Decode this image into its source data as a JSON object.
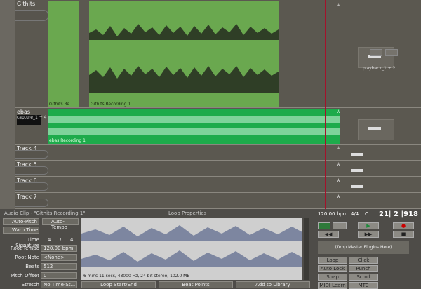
{
  "tracks": [
    {
      "name": "Githits",
      "clip_labels": [
        "Githits Re...",
        "Githits Recording 1"
      ],
      "plugin": "playback_1 + 2"
    },
    {
      "name": "ebas",
      "input": "capture_1 + 4",
      "clip_label": "ebas Recording 1"
    },
    {
      "name": "Track 4"
    },
    {
      "name": "Track 5"
    },
    {
      "name": "Track 6"
    },
    {
      "name": "Track 7"
    }
  ],
  "clip_props": {
    "header": "Audio Clip - \"Githits Recording 1\"",
    "title": "Loop Properties",
    "auto_pitch": "Auto-Pitch",
    "auto_tempo": "Auto-Tempo",
    "warp_time": "Warp Time",
    "time_sig_label": "Time Signature",
    "time_sig_num": "4",
    "time_sig_sep": "/",
    "time_sig_den": "4",
    "root_tempo_label": "Root Tempo",
    "root_tempo": "120.00 bpm",
    "root_note_label": "Root Note",
    "root_note": "<None>",
    "beats_label": "Beats",
    "beats": "512",
    "pitch_label": "Pitch Offset",
    "pitch": "0",
    "stretch_label": "Stretch",
    "stretch": "No Time-St...",
    "info": "6 mins 11 secs, 48000 Hz, 24 bit stereo, 102.0 MB",
    "loop_btn": "Loop Start/End",
    "beat_btn": "Beat Points",
    "lib_btn": "Add to Library"
  },
  "transport": {
    "tempo": "120.00 bpm",
    "timesig": "4/4",
    "key": "C",
    "position": "21| 2 |918",
    "drop_plugins": "(Drop Master Plugins Here)",
    "buttons": [
      "Loop",
      "Click",
      "Auto Lock",
      "Punch",
      "Snap",
      "Scroll",
      "MIDI Learn",
      "MTC"
    ]
  },
  "colors": {
    "clip_green": "#6aa84f",
    "clip_bright": "#1dab4b",
    "playhead": "#a3122b"
  },
  "icons": [
    "automation-a-icon",
    "play-icon",
    "record-icon",
    "stop-icon"
  ]
}
